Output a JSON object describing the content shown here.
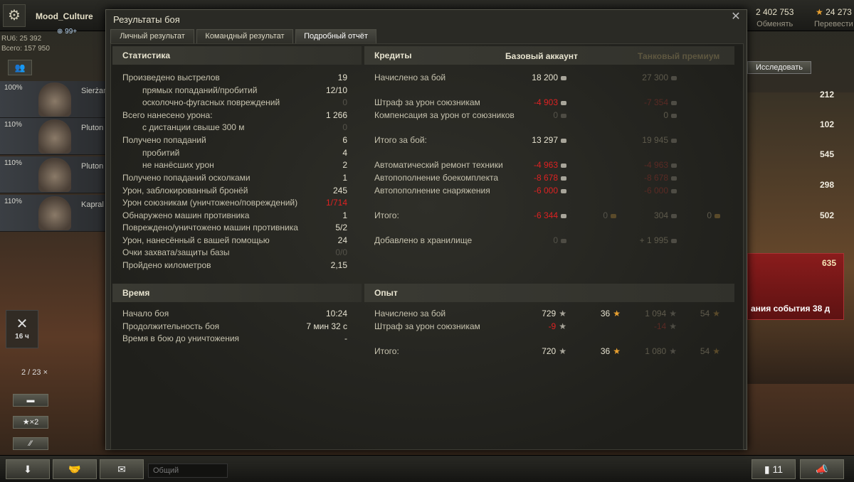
{
  "topbar": {
    "username": "Mood_Culture",
    "clan_badge": "99+",
    "free_xp": {
      "value": "2 402 753",
      "label": "Обменять"
    },
    "exp_convert": {
      "value": "24 273",
      "label": "Перевести"
    }
  },
  "sidebar": {
    "rub": "RU6: 25 392",
    "total": "Всего: 157 950",
    "crew": [
      {
        "pct": "100%",
        "name": "Sierżant"
      },
      {
        "pct": "110%",
        "name": "Pluton"
      },
      {
        "pct": "110%",
        "name": "Pluton"
      },
      {
        "pct": "110%",
        "name": "Kapral"
      }
    ],
    "timer": "16 ч",
    "slot_counter": "2 / 23",
    "x2_label": "×2"
  },
  "right_panel": {
    "research_label": "Исследовать",
    "stats": [
      "212",
      "102",
      "545",
      "298",
      "502"
    ],
    "event_count": "635",
    "event_text": "ания события 38 д"
  },
  "bottombar": {
    "chat_placeholder": "Общий",
    "notifications": "11"
  },
  "dialog": {
    "title": "Результаты боя",
    "tabs": [
      "Личный результат",
      "Командный результат",
      "Подробный отчёт"
    ],
    "active_tab": 2,
    "statistics": {
      "header": "Статистика",
      "rows": [
        {
          "label": "Произведено выстрелов",
          "value": "19"
        },
        {
          "label": "прямых попаданий/пробитий",
          "value": "12/10"
        },
        {
          "label": "осколочно-фугасных повреждений",
          "value": "0"
        },
        {
          "label": "Всего нанесено урона:",
          "value": "1 266"
        },
        {
          "label": "с дистанции свыше 300 м",
          "value": "0"
        },
        {
          "label": "Получено попаданий",
          "value": "6"
        },
        {
          "label": "пробитий",
          "value": "4"
        },
        {
          "label": "не нанёсших урон",
          "value": "2"
        },
        {
          "label": "Получено попаданий осколками",
          "value": "1"
        },
        {
          "label": "Урон, заблокированный бронёй",
          "value": "245"
        },
        {
          "label": "Урон союзникам (уничтожено/повреждений)",
          "value": "1/714"
        },
        {
          "label": "Обнаружено машин противника",
          "value": "1"
        },
        {
          "label": "Повреждено/уничтожено машин противника",
          "value": "5/2"
        },
        {
          "label": "Урон, нанесённый с вашей помощью",
          "value": "24"
        },
        {
          "label": "Очки захвата/защиты базы",
          "value": "0/0"
        },
        {
          "label": "Пройдено километров",
          "value": "2,15"
        }
      ]
    },
    "time": {
      "header": "Время",
      "rows": [
        {
          "label": "Начало боя",
          "value": "10:24"
        },
        {
          "label": "Продолжительность боя",
          "value": "7 мин 32 с"
        },
        {
          "label": "Время в бою до уничтожения",
          "value": "-"
        }
      ]
    },
    "credits": {
      "header": "Кредиты",
      "col_base": "Базовый аккаунт",
      "col_prem": "Танковый премиум",
      "rows": [
        {
          "label": "Начислено за бой",
          "base": "18 200",
          "prem": "27 300"
        },
        {
          "label": "Штраф за урон союзникам",
          "base": "-4 903",
          "prem": "-7 354"
        },
        {
          "label": "Компенсация за урон от союзников",
          "base": "0",
          "prem": "0"
        },
        {
          "label": "Итого за бой:",
          "base": "13 297",
          "prem": "19 945"
        },
        {
          "label": "Автоматический ремонт техники",
          "base": "-4 963",
          "prem": "-4 963"
        },
        {
          "label": "Автопополнение боекомплекта",
          "base": "-8 678",
          "prem": "-8 678"
        },
        {
          "label": "Автопополнение снаряжения",
          "base": "-6 000",
          "prem": "-6 000"
        },
        {
          "label": "Итого:",
          "base": "-6 344",
          "base_gold": "0",
          "prem": "304",
          "prem_gold": "0"
        },
        {
          "label": "Добавлено в хранилище",
          "base": "0",
          "prem": "+ 1 995"
        }
      ]
    },
    "experience": {
      "header": "Опыт",
      "rows": [
        {
          "label": "Начислено за бой",
          "base": "729",
          "base_free": "36",
          "prem": "1 094",
          "prem_free": "54"
        },
        {
          "label": "Штраф за урон союзникам",
          "base": "-9",
          "prem": "-14"
        },
        {
          "label": "Итого:",
          "base": "720",
          "base_free": "36",
          "prem": "1 080",
          "prem_free": "54"
        }
      ]
    }
  },
  "colors": {
    "negative": "#d22",
    "gold": "#e8a030",
    "accent_red": "#c8201a"
  }
}
